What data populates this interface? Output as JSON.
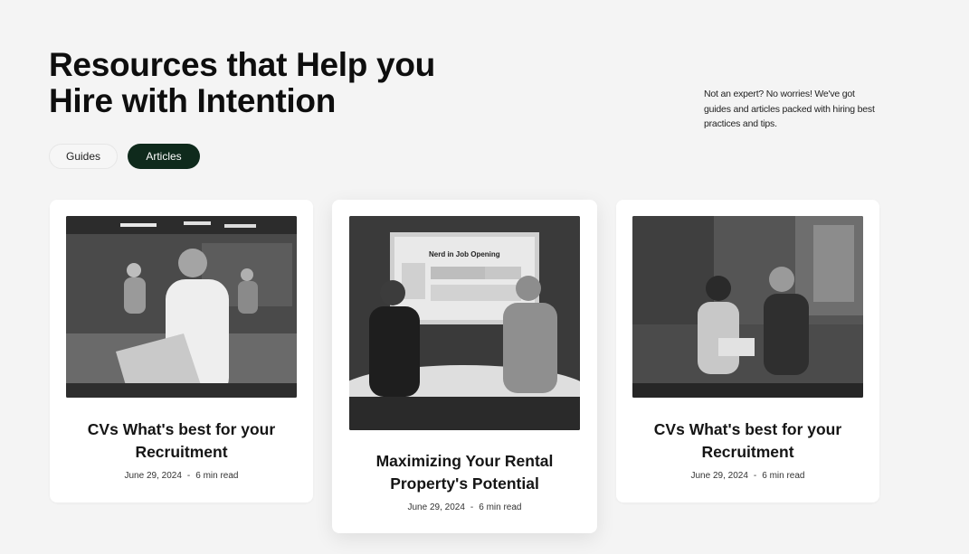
{
  "hero": {
    "title_line1": "Resources that Help you",
    "title_line2": "Hire with Intention",
    "intro": "Not an expert? No worries! We've got guides and articles packed with hiring best practices and tips."
  },
  "tabs": [
    {
      "label": "Guides",
      "active": false
    },
    {
      "label": "Articles",
      "active": true
    }
  ],
  "articles": [
    {
      "title": "CVs What's best for your Recruitment",
      "date": "June 29, 2024",
      "separator": "-",
      "read_time": "6 min read"
    },
    {
      "title": "Maximizing Your Rental Property's Potential",
      "date": "June 29, 2024",
      "separator": "-",
      "read_time": "6 min read",
      "screen_text": "Nerd in Job Opening"
    },
    {
      "title": "CVs What's best for your Recruitment",
      "date": "June 29, 2024",
      "separator": "-",
      "read_time": "6 min read"
    }
  ],
  "colors": {
    "background": "#f4f4f4",
    "active_tab": "#0f2a1c",
    "card": "#ffffff"
  }
}
